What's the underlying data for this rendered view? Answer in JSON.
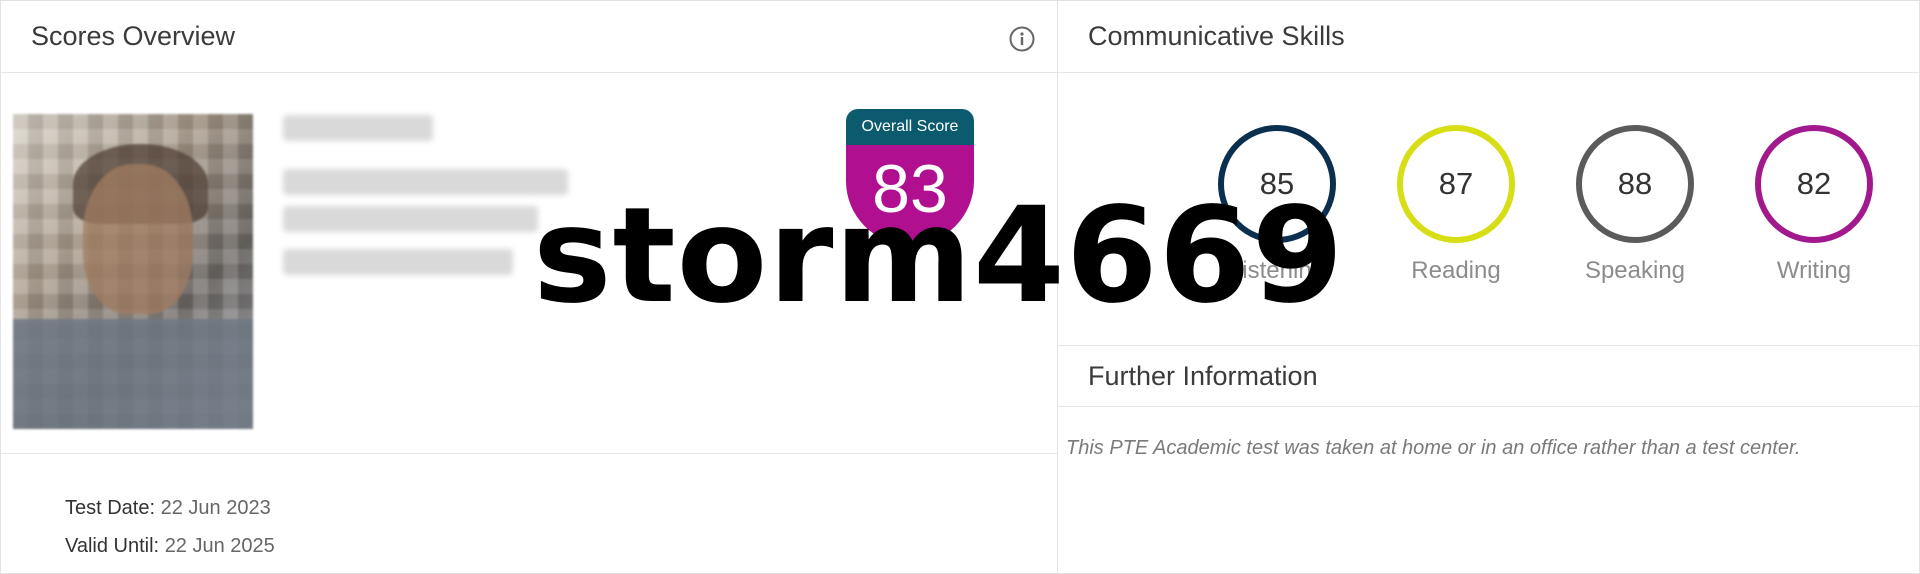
{
  "scores_overview": {
    "title": "Scores Overview",
    "info_icon": "info-icon",
    "overall_score_label": "Overall Score",
    "overall_score": "83",
    "test_date_label": "Test Date:",
    "test_date": "22 Jun 2023",
    "valid_until_label": "Valid Until:",
    "valid_until": "22 Jun 2025"
  },
  "communicative_skills": {
    "title": "Communicative Skills",
    "skills": [
      {
        "name": "Listening",
        "score": "85",
        "color": "#0b2f4f"
      },
      {
        "name": "Reading",
        "score": "87",
        "color": "#d8de16"
      },
      {
        "name": "Speaking",
        "score": "88",
        "color": "#5b5b5b"
      },
      {
        "name": "Writing",
        "score": "82",
        "color": "#a2188d"
      }
    ]
  },
  "further_information": {
    "title": "Further Information",
    "text": "This PTE Academic test was taken at home or in an office rather than a test center."
  },
  "watermark": "storm4669",
  "colors": {
    "overall_band": "#0c5a6d",
    "overall_body": "#b0108f"
  }
}
